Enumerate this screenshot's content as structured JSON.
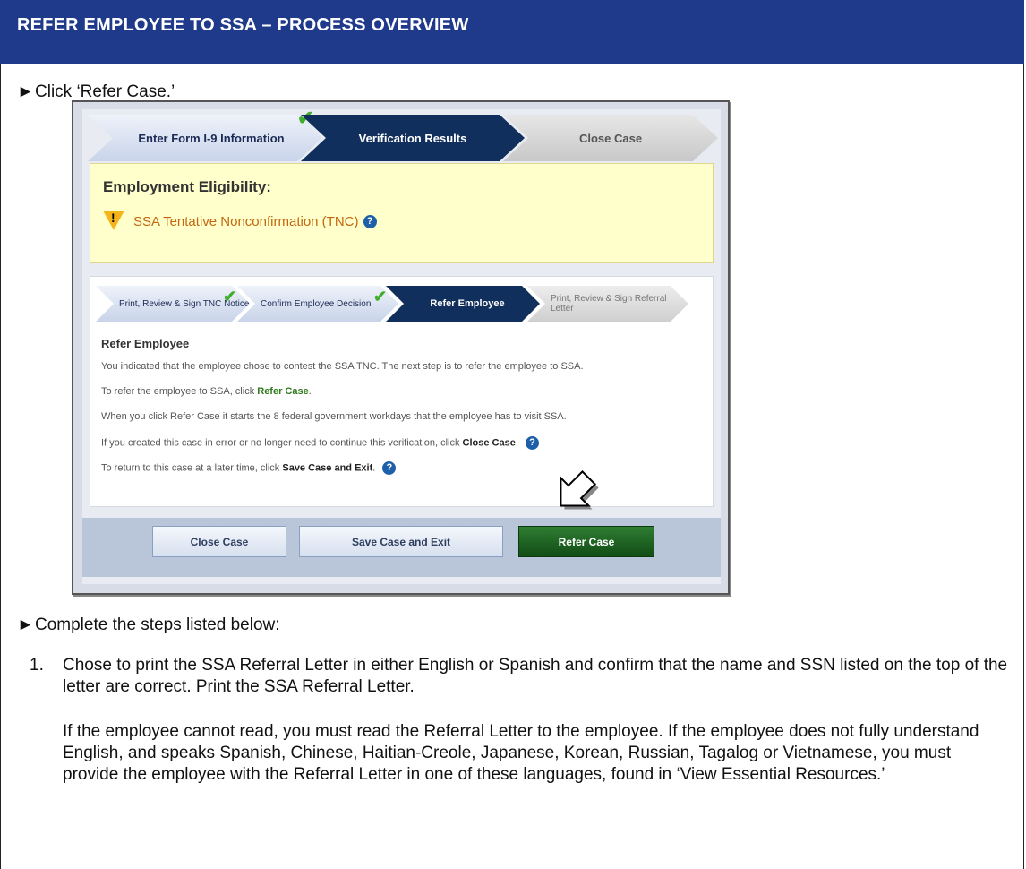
{
  "header": {
    "title": "REFER EMPLOYEE TO SSA – PROCESS OVERVIEW"
  },
  "bullets": [
    {
      "arrow": "►",
      "text": "Click ‘Refer Case.’"
    },
    {
      "arrow": "►",
      "text": "Complete the steps listed below:"
    }
  ],
  "screenshot": {
    "main_steps": [
      {
        "label": "Enter Form I-9 Information",
        "state": "complete"
      },
      {
        "label": "Verification Results",
        "state": "current"
      },
      {
        "label": "Close Case",
        "state": "pending"
      }
    ],
    "eligibility": {
      "title": "Employment Eligibility:",
      "status": "SSA Tentative Nonconfirmation (TNC)"
    },
    "sub_steps": [
      {
        "label": "Print, Review & Sign TNC Notice",
        "state": "complete"
      },
      {
        "label": "Confirm Employee Decision",
        "state": "complete"
      },
      {
        "label": "Refer Employee",
        "state": "current"
      },
      {
        "label": "Print, Review & Sign Referral Letter",
        "state": "pending"
      }
    ],
    "refer": {
      "heading": "Refer Employee",
      "line1": "You indicated that the employee chose to contest the SSA TNC. The next step is to refer the employee to SSA.",
      "line2_prefix": "To refer the employee to SSA, click ",
      "line2_action": "Refer Case",
      "line2_suffix": ".",
      "line3": "When you click Refer Case it starts the 8 federal government workdays that the employee has to visit SSA.",
      "line4_prefix": "If you created this case in error or no longer need to continue this verification, click ",
      "line4_action": "Close Case",
      "line4_suffix": ".",
      "line5_prefix": "To return to this case at a later time, click ",
      "line5_action": "Save Case and Exit",
      "line5_suffix": "."
    },
    "buttons": {
      "close": "Close Case",
      "save": "Save Case and Exit",
      "refer": "Refer Case"
    },
    "help_glyph": "?",
    "check_glyph": "✔"
  },
  "steps": [
    {
      "number": "1.",
      "text": "Chose to print the SSA Referral Letter in either English or Spanish and confirm that the name and SSN listed on the top of the letter are correct. Print the SSA Referral Letter."
    }
  ],
  "note": "If the employee cannot read, you must read the Referral Letter to the employee. If the employee does not fully understand English, and speaks Spanish, Chinese, Haitian-Creole, Japanese, Korean, Russian, Tagalog or Vietnamese, you must provide the employee with the Referral Letter in one of these languages, found in ‘View Essential Resources.’",
  "colors": {
    "header_bg": "#1f3a8a",
    "step_current": "#112f5c",
    "eligibility_bg": "#ffffcc",
    "status_text": "#c1670f",
    "refer_button": "#2e7d32"
  }
}
